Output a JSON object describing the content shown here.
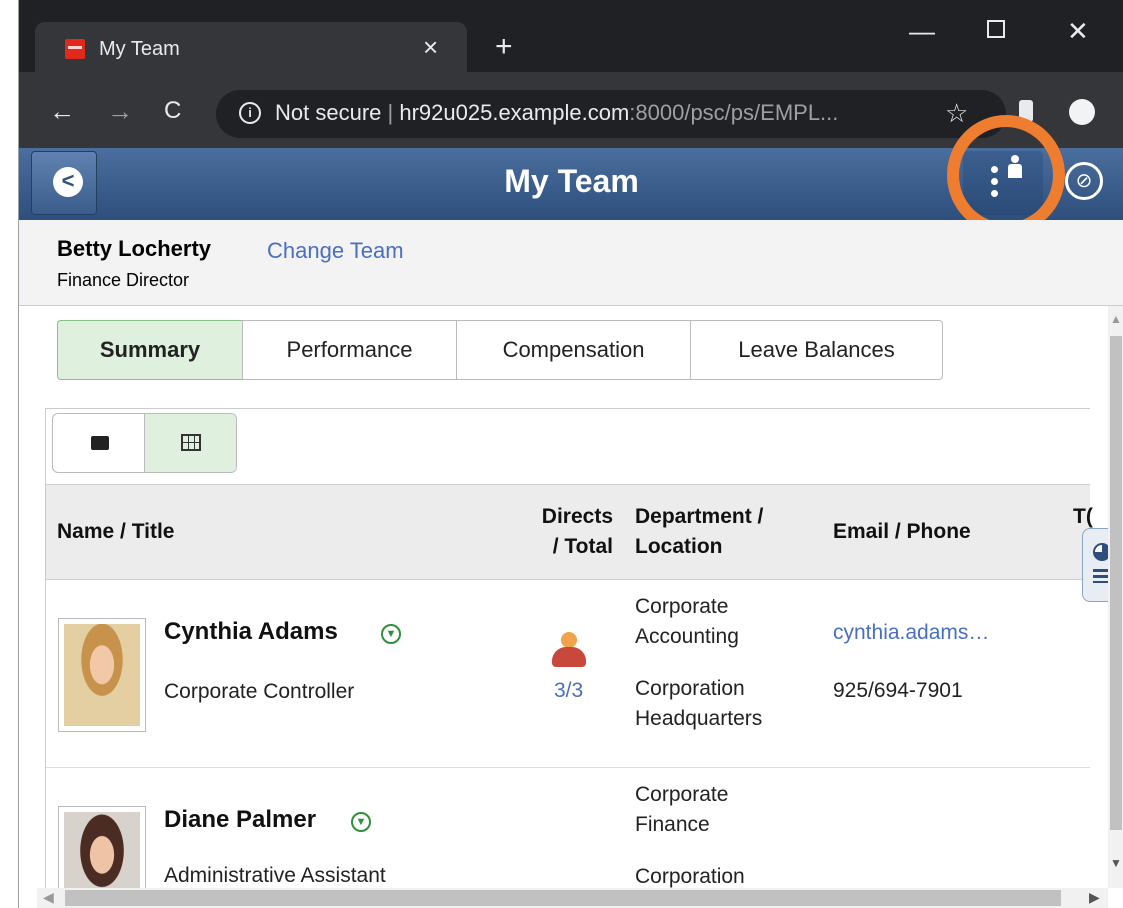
{
  "browser": {
    "tab_title": "My Team",
    "tab_close": "×",
    "new_tab": "+",
    "minimize": "—",
    "close": "✕",
    "back": "←",
    "forward": "→",
    "reload": "C",
    "info": "i",
    "url_security": "Not secure",
    "url_separator": "|",
    "url_host": "hr92u025.example.com",
    "url_rest": ":8000/psc/ps/EMPL...",
    "bookmark": "☆"
  },
  "banner": {
    "back_label": "<",
    "title": "My Team",
    "navbar_label": "⊘"
  },
  "manager": {
    "name": "Betty Locherty",
    "change_team": "Change Team",
    "title": "Finance Director"
  },
  "tabs": [
    {
      "label": "Summary",
      "selected": true
    },
    {
      "label": "Performance",
      "selected": false
    },
    {
      "label": "Compensation",
      "selected": false
    },
    {
      "label": "Leave Balances",
      "selected": false
    }
  ],
  "view_toggle": {
    "selected": "grid"
  },
  "grid": {
    "columns": {
      "name": "Name / Title",
      "directs_line1": "Directs",
      "directs_line2": "/ Total",
      "dept_line1": "Department /",
      "dept_line2": "Location",
      "email": "Email / Phone",
      "cut": "T("
    },
    "rows": [
      {
        "name": "Cynthia Adams",
        "title": "Corporate Controller",
        "directs": "3/3",
        "department_line1": "Corporate",
        "department_line2": "Accounting",
        "location_line1": "Corporation",
        "location_line2": "Headquarters",
        "email": "cynthia.adams…",
        "phone": "925/694-7901"
      },
      {
        "name": "Diane Palmer",
        "title": "Administrative Assistant",
        "department_line1": "Corporate",
        "department_line2": "Finance",
        "location_line1": "Corporation"
      }
    ]
  },
  "scroll": {
    "up": "▲",
    "down": "▼",
    "left": "◀",
    "right": "▶"
  },
  "colors": {
    "banner": "#2e4f7c",
    "highlight_ring": "#ef7d2f",
    "selected_tab": "#dff0de",
    "link": "#4a6fc1"
  }
}
